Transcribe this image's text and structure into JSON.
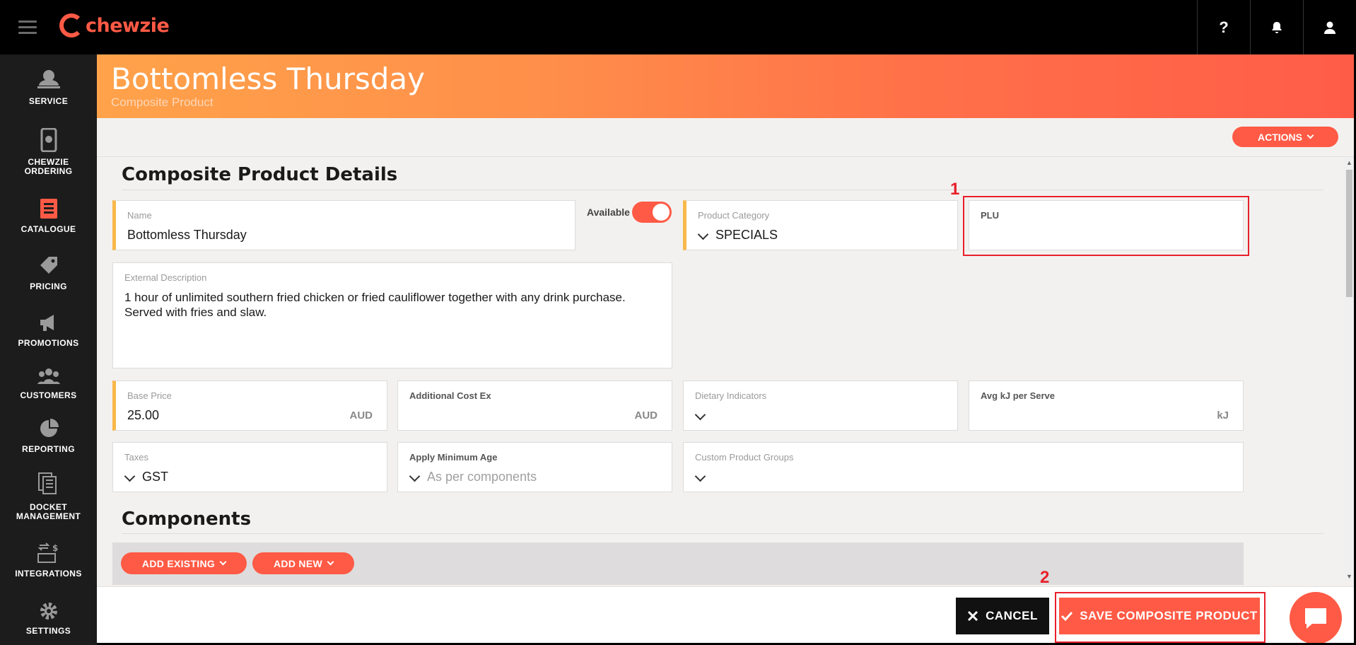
{
  "brand": {
    "name": "chewzie",
    "accent": "#ff5a45"
  },
  "topbar": {
    "help_icon": "question-icon",
    "help_label": "?",
    "notification_icon": "bell-icon",
    "user_icon": "user-icon"
  },
  "sidebar": {
    "items": [
      {
        "label": "SERVICE",
        "icon": "service-icon"
      },
      {
        "label": "CHEWZIE ORDERING",
        "icon": "phone-ordering-icon"
      },
      {
        "label": "CATALOGUE",
        "icon": "catalogue-icon"
      },
      {
        "label": "PRICING",
        "icon": "price-tag-icon"
      },
      {
        "label": "PROMOTIONS",
        "icon": "megaphone-icon"
      },
      {
        "label": "CUSTOMERS",
        "icon": "customers-icon"
      },
      {
        "label": "REPORTING",
        "icon": "pie-chart-icon"
      },
      {
        "label": "DOCKET MANAGEMENT",
        "icon": "dockets-icon"
      },
      {
        "label": "INTEGRATIONS",
        "icon": "integrations-icon"
      },
      {
        "label": "SETTINGS",
        "icon": "gear-icon"
      }
    ]
  },
  "header": {
    "title": "Bottomless Thursday",
    "subtitle": "Composite Product",
    "actions_label": "ACTIONS"
  },
  "details": {
    "section_title": "Composite Product Details",
    "name_label": "Name",
    "name_value": "Bottomless Thursday",
    "available_label": "Available",
    "available": true,
    "category_label": "Product Category",
    "category_value": "SPECIALS",
    "plu_label": "PLU",
    "plu_value": "",
    "description_label": "External Description",
    "description_value": "1 hour of unlimited southern fried chicken or fried cauliflower together with any drink purchase. Served with fries and slaw.",
    "base_price_label": "Base Price",
    "base_price_value": "25.00",
    "base_price_unit": "AUD",
    "additional_cost_label": "Additional Cost Ex",
    "additional_cost_value": "",
    "additional_cost_unit": "AUD",
    "dietary_label": "Dietary Indicators",
    "dietary_value": "",
    "kj_label": "Avg kJ per Serve",
    "kj_value": "",
    "kj_unit": "kJ",
    "taxes_label": "Taxes",
    "taxes_value": "GST",
    "min_age_label": "Apply Minimum Age",
    "min_age_placeholder": "As per components",
    "custom_groups_label": "Custom Product Groups",
    "custom_groups_value": ""
  },
  "components": {
    "section_title": "Components",
    "add_existing_label": "ADD EXISTING",
    "add_new_label": "ADD NEW"
  },
  "footer": {
    "cancel_label": "CANCEL",
    "save_label": "SAVE COMPOSITE PRODUCT",
    "chat_icon": "chat-icon"
  },
  "annotations": [
    {
      "label": "1"
    },
    {
      "label": "2"
    }
  ]
}
